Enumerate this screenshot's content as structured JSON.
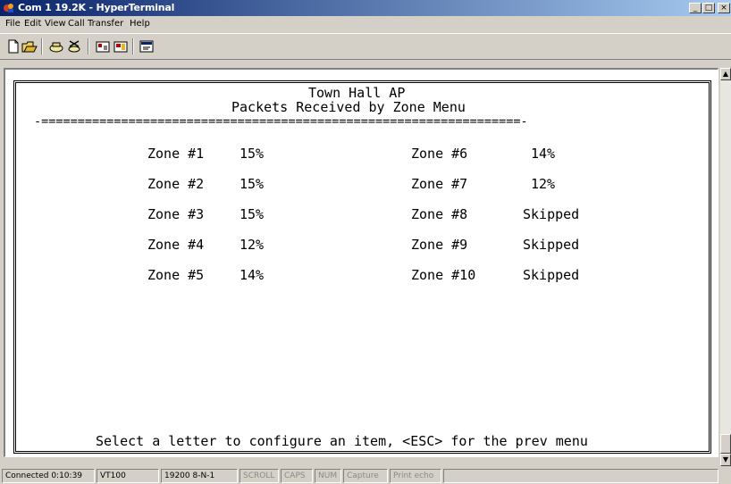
{
  "window": {
    "title": "Com 1 19.2K - HyperTerminal",
    "minimize_glyph": "_",
    "maximize_glyph": "□",
    "close_glyph": "×"
  },
  "menu": [
    "File",
    "Edit",
    "View",
    "Call",
    "Transfer",
    "Help"
  ],
  "toolbar": {
    "icons": [
      "new-icon",
      "open-icon",
      "call-icon",
      "disconnect-icon",
      "send-icon",
      "receive-icon",
      "properties-icon"
    ]
  },
  "terminal": {
    "heading": "Town Hall AP",
    "subheading": "Packets Received by Zone Menu",
    "divider": "-==================================================================-",
    "zones_left": [
      {
        "label": "Zone #1",
        "value": "15%"
      },
      {
        "label": "Zone #2",
        "value": "15%"
      },
      {
        "label": "Zone #3",
        "value": "15%"
      },
      {
        "label": "Zone #4",
        "value": "12%"
      },
      {
        "label": "Zone #5",
        "value": "14%"
      }
    ],
    "zones_right": [
      {
        "label": "Zone #6",
        "value": "14%"
      },
      {
        "label": "Zone #7",
        "value": "12%"
      },
      {
        "label": "Zone #8",
        "value": "Skipped"
      },
      {
        "label": "Zone #9",
        "value": "Skipped"
      },
      {
        "label": "Zone #10",
        "value": "Skipped"
      }
    ],
    "prompt": "Select a letter to configure an item, <ESC> for the prev menu"
  },
  "scrollbar": {
    "up_glyph": "▲",
    "down_glyph": "▼"
  },
  "status": {
    "connected": "Connected 0:10:39",
    "emulation": "VT100",
    "port": "19200 8-N-1",
    "scroll": "SCROLL",
    "caps": "CAPS",
    "num": "NUM",
    "capture": "Capture",
    "print_echo": "Print echo"
  }
}
